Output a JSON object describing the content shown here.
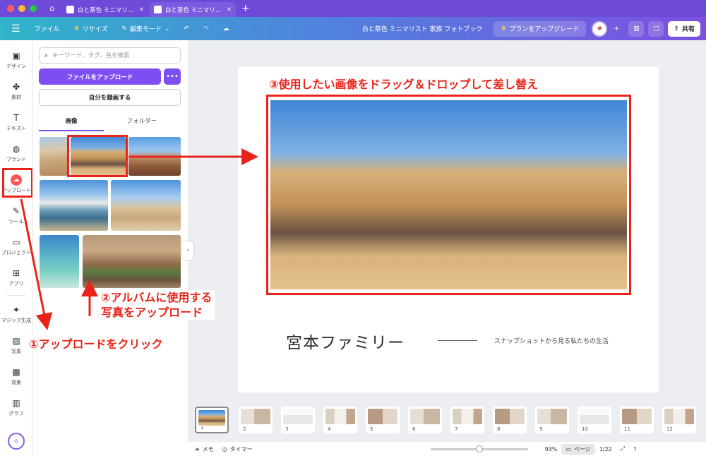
{
  "browser": {
    "tabs": [
      {
        "title": "白と茶色 ミニマリスト...",
        "close": "✕",
        "active": false
      },
      {
        "title": "白と茶色 ミニマリスト...",
        "close": "✕",
        "active": true
      }
    ],
    "new_tab": "+"
  },
  "toolbar": {
    "file": "ファイル",
    "resize": "リサイズ",
    "edit_mode": "編集モード",
    "doc_title": "白と茶色 ミニマリスト 家族 フォトブック",
    "upgrade": "プランをアップグレード",
    "share": "共有"
  },
  "rail": {
    "items": [
      {
        "label": "デザイン",
        "icon": "▣"
      },
      {
        "label": "素材",
        "icon": "✤"
      },
      {
        "label": "テキスト",
        "icon": "T"
      },
      {
        "label": "ブランド",
        "icon": "◍"
      },
      {
        "label": "アップロード",
        "icon": "☁"
      },
      {
        "label": "ツール",
        "icon": "✎"
      },
      {
        "label": "プロジェクト",
        "icon": "▭"
      },
      {
        "label": "アプリ",
        "icon": "⊞"
      },
      {
        "label": "マジック生成",
        "icon": "✦"
      },
      {
        "label": "写真",
        "icon": "▨"
      },
      {
        "label": "背景",
        "icon": "▩"
      },
      {
        "label": "グラフ",
        "icon": "▥"
      }
    ]
  },
  "panel": {
    "search_placeholder": "キーワード、タグ、色を検索",
    "upload_button": "ファイルをアップロード",
    "more_button": "•••",
    "record_button": "自分を録画する",
    "tabs": [
      "画像",
      "フォルダー"
    ]
  },
  "canvas": {
    "family_name": "宮本ファミリー",
    "tagline": "スナップショットから見る私たちの生活"
  },
  "annotations": {
    "step3": "③使用したい画像をドラッグ＆ドロップして差し替え",
    "step2_line1": "②アルバムに使用する",
    "step2_line2": "写真をアップロード",
    "step1": "①アップロードをクリック"
  },
  "pages": {
    "numbers": [
      "1",
      "2",
      "3",
      "4",
      "5",
      "6",
      "7",
      "8",
      "9",
      "10",
      "11",
      "12"
    ],
    "current": "1"
  },
  "status": {
    "notes": "メモ",
    "timer": "タイマー",
    "zoom": "93%",
    "pages_label": "ページ",
    "page_count": "1/22"
  },
  "colors": {
    "accent": "#7d4ff0",
    "annotation_red": "#e8241a",
    "upload_red": "#ff5757"
  }
}
